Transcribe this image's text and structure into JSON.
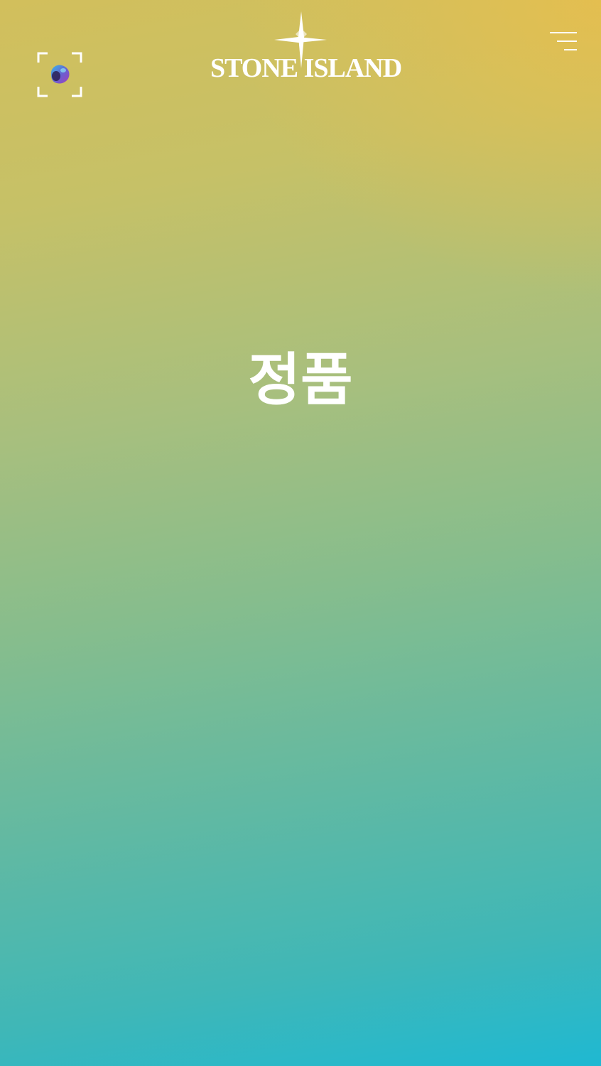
{
  "header": {
    "brand_name": "STONE ISLAND",
    "logo_icon": "compass-rose-icon",
    "scan_icon": "ar-scan-icon",
    "menu_icon": "hamburger-menu-icon"
  },
  "main": {
    "title": "정품"
  },
  "colors": {
    "gradient_top": "#d2bf5c",
    "gradient_top_right": "#ecbe4a",
    "gradient_middle": "#86bd8d",
    "gradient_bottom": "#1fb8d2",
    "text": "#ffffff"
  }
}
